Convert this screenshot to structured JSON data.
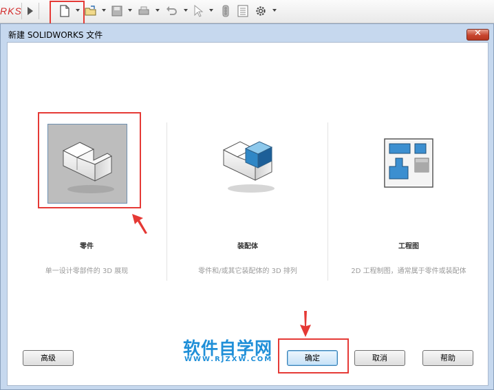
{
  "toolbar": {
    "logo_fragment": "RKS",
    "icons": [
      "play-icon",
      "new-document-icon",
      "open-folder-icon",
      "save-icon",
      "print-icon",
      "undo-icon",
      "select-arrow-icon",
      "traffic-light-icon",
      "file-properties-icon",
      "gear-icon"
    ]
  },
  "dialog": {
    "title": "新建 SOLIDWORKS 文件",
    "close_symbol": "✕",
    "templates": [
      {
        "label": "零件",
        "description": "单一设计零部件的 3D 展现",
        "icon": "part-icon"
      },
      {
        "label": "装配体",
        "description": "零件和/或其它装配体的 3D 排列",
        "icon": "assembly-icon"
      },
      {
        "label": "工程图",
        "description": "2D 工程制图，通常属于零件或装配体",
        "icon": "drawing-icon"
      }
    ],
    "buttons": {
      "advanced": "高级",
      "ok": "确定",
      "cancel": "取消",
      "help": "帮助"
    }
  },
  "watermark": {
    "main": "软件自学网",
    "sub": "WWW.RJZXW.COM"
  },
  "colors": {
    "highlight": "#e53935",
    "watermark": "#1f8fd8"
  }
}
